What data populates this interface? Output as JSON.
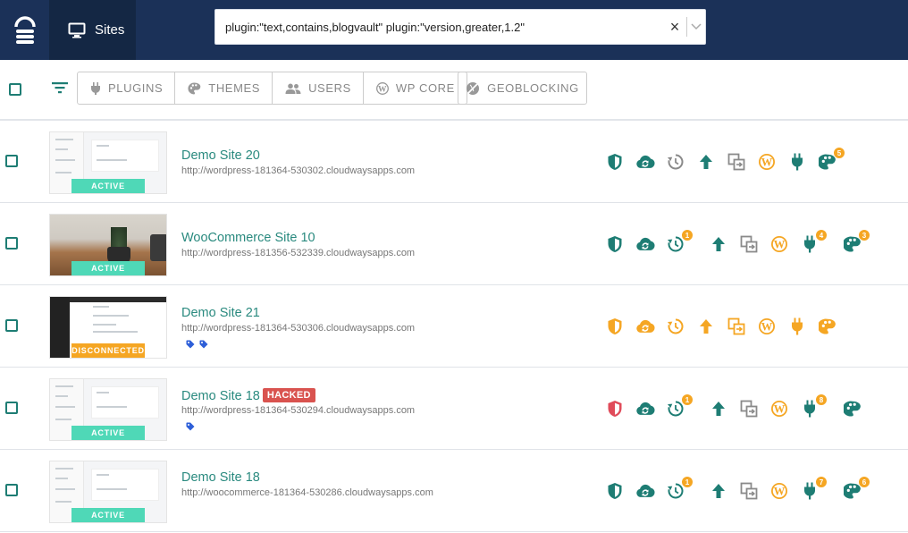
{
  "header": {
    "sites_label": "Sites",
    "search_value": "plugin:\"text,contains,blogvault\" plugin:\"version,greater,1.2\"",
    "clear_glyph": "×"
  },
  "filters": {
    "buttons": [
      "PLUGINS",
      "THEMES",
      "USERS",
      "WP CORE"
    ],
    "geoblocking": "GEOBLOCKING"
  },
  "colors": {
    "green": "#1e7d74",
    "orange": "#f5a623",
    "red": "#e04b5a",
    "gray": "#8a8a8a"
  },
  "sites": [
    {
      "name": "Demo Site 20",
      "url": "http://wordpress-181364-530302.cloudwaysapps.com",
      "status": "ACTIVE",
      "hacked": "",
      "icons": [
        {
          "name": "shield-icon",
          "color": "green",
          "count": ""
        },
        {
          "name": "cloud-sync-icon",
          "color": "green",
          "count": ""
        },
        {
          "name": "clock-icon",
          "color": "gray",
          "count": ""
        },
        {
          "name": "arrow-up-icon",
          "color": "green",
          "count": ""
        },
        {
          "name": "staging-icon",
          "color": "gray",
          "count": ""
        },
        {
          "name": "wordpress-icon",
          "color": "orange",
          "count": ""
        },
        {
          "name": "plug-icon",
          "color": "green",
          "count": ""
        },
        {
          "name": "palette-icon",
          "color": "green",
          "count": "5"
        }
      ]
    },
    {
      "name": "WooCommerce Site 10",
      "url": "http://wordpress-181356-532339.cloudwaysapps.com",
      "status": "ACTIVE",
      "hacked": "",
      "icons": [
        {
          "name": "shield-icon",
          "color": "green",
          "count": ""
        },
        {
          "name": "cloud-sync-icon",
          "color": "green",
          "count": ""
        },
        {
          "name": "clock-icon",
          "color": "green",
          "count": "1"
        },
        {
          "name": "arrow-up-icon",
          "color": "green",
          "count": ""
        },
        {
          "name": "staging-icon",
          "color": "gray",
          "count": ""
        },
        {
          "name": "wordpress-icon",
          "color": "orange",
          "count": ""
        },
        {
          "name": "plug-icon",
          "color": "green",
          "count": "4"
        },
        {
          "name": "palette-icon",
          "color": "green",
          "count": "3"
        }
      ]
    },
    {
      "name": "Demo Site 21",
      "url": "http://wordpress-181364-530306.cloudwaysapps.com",
      "status": "DISCONNECTED",
      "hacked": "",
      "tags": 2,
      "icons": [
        {
          "name": "shield-icon",
          "color": "orange",
          "count": ""
        },
        {
          "name": "cloud-sync-icon",
          "color": "orange",
          "count": ""
        },
        {
          "name": "clock-icon",
          "color": "orange",
          "count": ""
        },
        {
          "name": "arrow-up-icon",
          "color": "orange",
          "count": ""
        },
        {
          "name": "staging-icon",
          "color": "orange",
          "count": ""
        },
        {
          "name": "wordpress-icon",
          "color": "orange",
          "count": ""
        },
        {
          "name": "plug-icon",
          "color": "orange",
          "count": ""
        },
        {
          "name": "palette-icon",
          "color": "orange",
          "count": ""
        }
      ]
    },
    {
      "name": "Demo Site 18",
      "url": "http://wordpress-181364-530294.cloudwaysapps.com",
      "status": "ACTIVE",
      "hacked": "HACKED",
      "tags": 1,
      "icons": [
        {
          "name": "shield-icon",
          "color": "red",
          "count": ""
        },
        {
          "name": "cloud-sync-icon",
          "color": "green",
          "count": ""
        },
        {
          "name": "clock-icon",
          "color": "green",
          "count": "1"
        },
        {
          "name": "arrow-up-icon",
          "color": "green",
          "count": ""
        },
        {
          "name": "staging-icon",
          "color": "gray",
          "count": ""
        },
        {
          "name": "wordpress-icon",
          "color": "orange",
          "count": ""
        },
        {
          "name": "plug-icon",
          "color": "green",
          "count": "8"
        },
        {
          "name": "palette-icon",
          "color": "green",
          "count": ""
        }
      ]
    },
    {
      "name": "Demo Site 18",
      "url": "http://woocommerce-181364-530286.cloudwaysapps.com",
      "status": "ACTIVE",
      "hacked": "",
      "icons": [
        {
          "name": "shield-icon",
          "color": "green",
          "count": ""
        },
        {
          "name": "cloud-sync-icon",
          "color": "green",
          "count": ""
        },
        {
          "name": "clock-icon",
          "color": "green",
          "count": "1"
        },
        {
          "name": "arrow-up-icon",
          "color": "green",
          "count": ""
        },
        {
          "name": "staging-icon",
          "color": "gray",
          "count": ""
        },
        {
          "name": "wordpress-icon",
          "color": "orange",
          "count": ""
        },
        {
          "name": "plug-icon",
          "color": "green",
          "count": "7"
        },
        {
          "name": "palette-icon",
          "color": "green",
          "count": "6"
        }
      ]
    }
  ]
}
